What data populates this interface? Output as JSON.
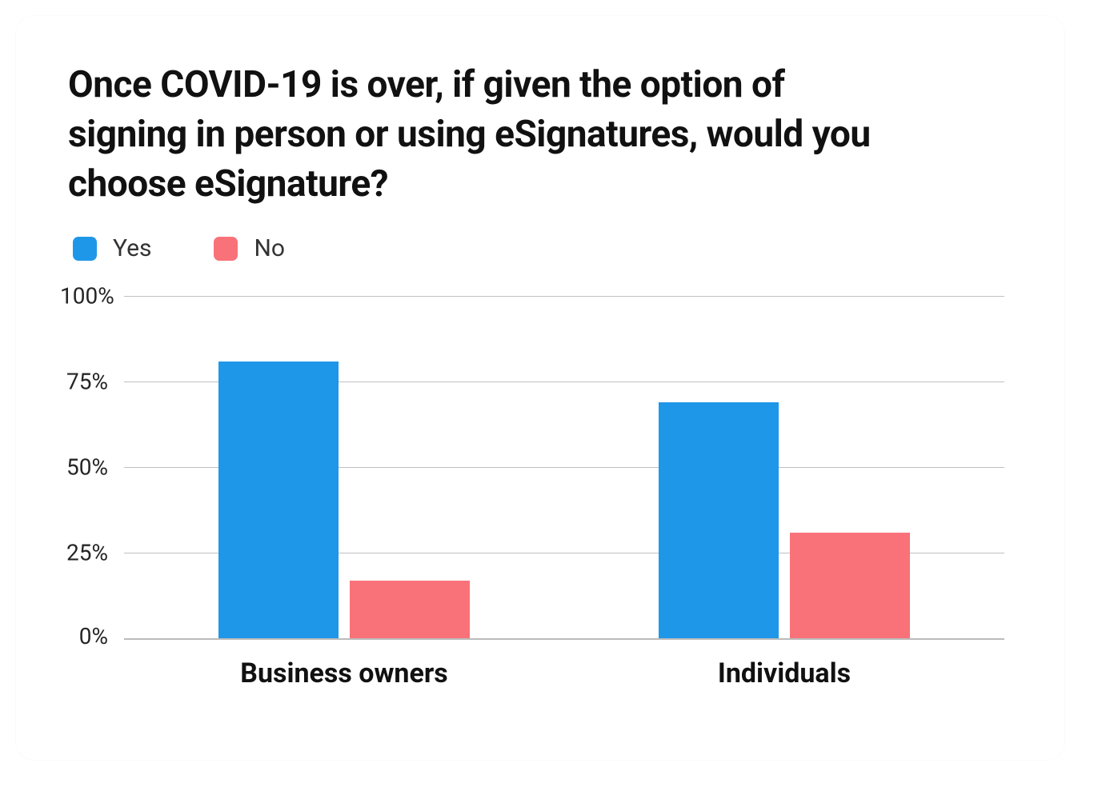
{
  "chart_data": {
    "type": "bar",
    "title": "Once COVID-19 is over, if given the option of signing in person or using eSignatures, would you choose eSignature?",
    "xlabel": "",
    "ylabel": "",
    "ylim": [
      0,
      100
    ],
    "y_ticks": [
      "0%",
      "25%",
      "50%",
      "75%",
      "100%"
    ],
    "categories": [
      "Business owners",
      "Individuals"
    ],
    "series": [
      {
        "name": "Yes",
        "color": "#1f97e9",
        "values": [
          81,
          69
        ]
      },
      {
        "name": "No",
        "color": "#f97279",
        "values": [
          17,
          31
        ]
      }
    ]
  }
}
